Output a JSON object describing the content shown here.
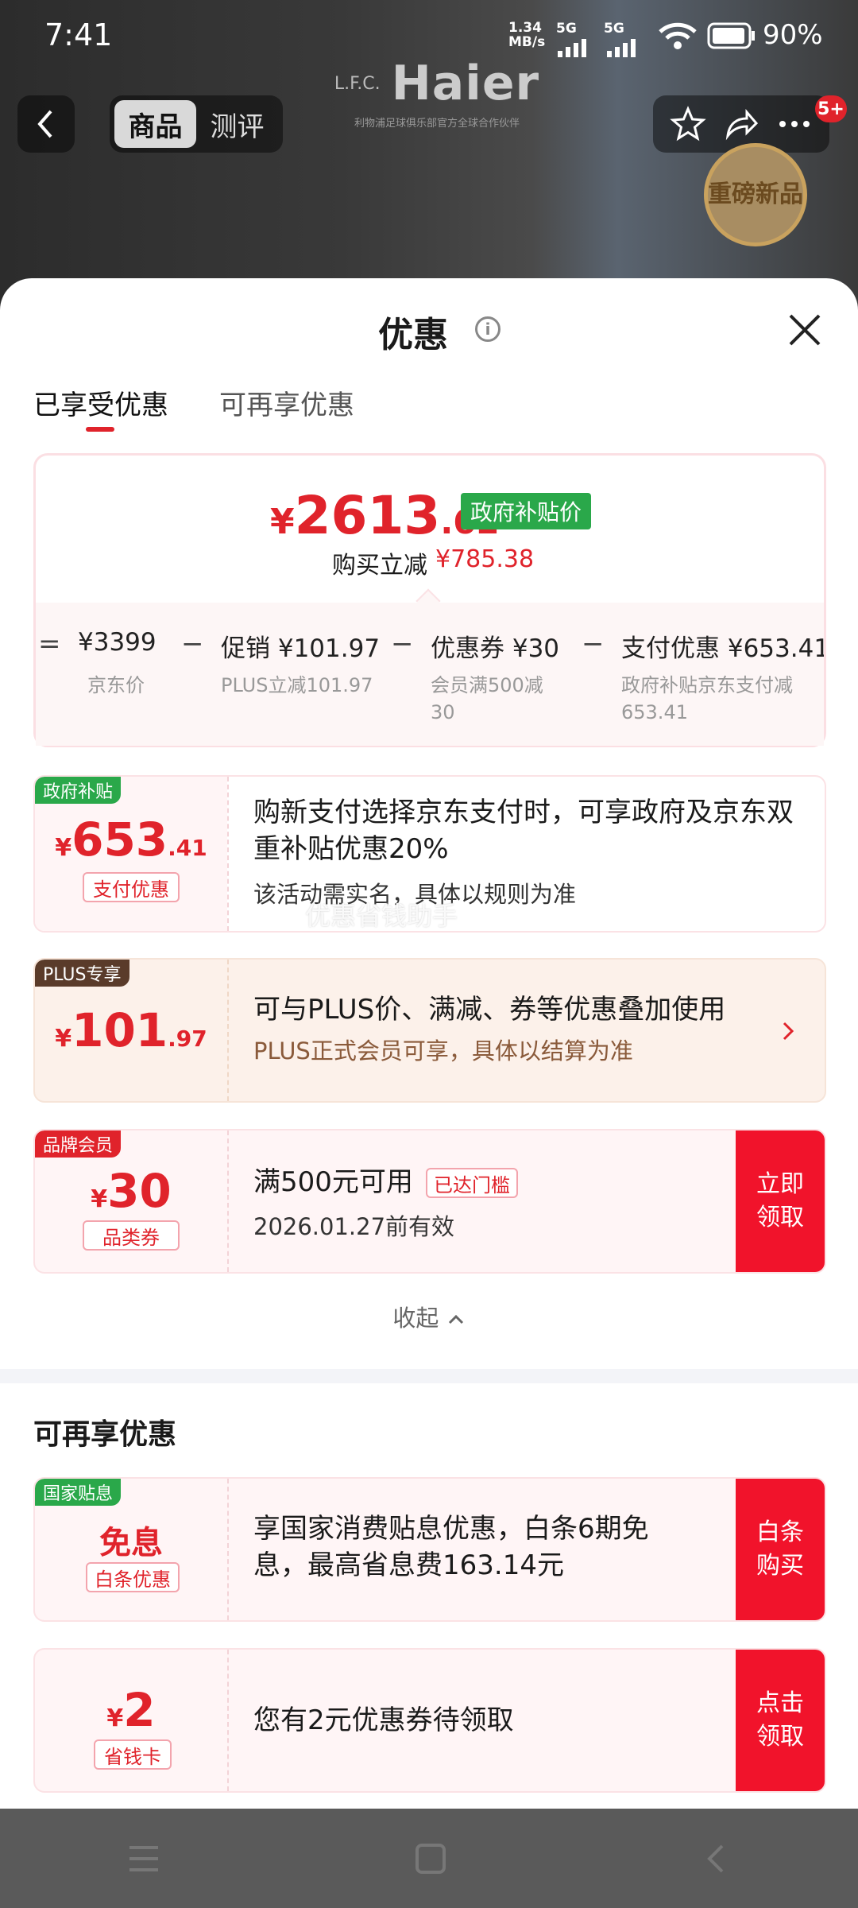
{
  "status_bar": {
    "time": "7:41",
    "net_speed": "1.34 MB/s",
    "signal1": "5G",
    "signal2": "5G",
    "battery": "90%"
  },
  "top_nav": {
    "tab_product": "商品",
    "tab_review": "测评"
  },
  "brand": {
    "logo_text": "Haier",
    "sub_text": "利物浦足球俱乐部官方全球合作伙伴",
    "club": "L.F.C."
  },
  "badge": {
    "notification": "5+",
    "new_product": "重磅新品"
  },
  "sheet": {
    "title": "优惠",
    "tabs": [
      "已享受优惠",
      "可再享优惠"
    ]
  },
  "summary": {
    "price_currency": "¥",
    "price_int": "2613",
    "price_dec": ".62",
    "gov_price_tag": "政府补贴价",
    "reduce_label": "购买立减",
    "reduce_value": "¥785.38",
    "breakdown": [
      {
        "op": "=",
        "label": "¥3399",
        "sub": "京东价"
      },
      {
        "op": "−",
        "label": "促销 ¥101.97",
        "sub": "PLUS立减101.97"
      },
      {
        "op": "−",
        "label": "优惠券 ¥30",
        "sub": "会员满500减30"
      },
      {
        "op": "−",
        "label": "支付优惠 ¥653.41",
        "sub": "政府补贴京东支付减653.41"
      }
    ]
  },
  "cards_applied": [
    {
      "tag": "政府补贴",
      "currency": "¥",
      "amount_int": "653",
      "amount_dec": ".41",
      "sub_tag": "支付优惠",
      "text": "购新支付选择京东支付时，可享政府及京东双重补贴优惠20%",
      "note": "该活动需实名，具体以规则为准",
      "watermark": "优惠省钱助手"
    },
    {
      "tag": "PLUS专享",
      "currency": "¥",
      "amount_int": "101",
      "amount_dec": ".97",
      "text": "可与PLUS价、满减、券等优惠叠加使用",
      "note": "PLUS正式会员可享，具体以结算为准"
    },
    {
      "tag": "品牌会员",
      "currency": "¥",
      "amount_int": "30",
      "sub_tag": "品类券",
      "text": "满500元可用",
      "threshold_badge": "已达门槛",
      "note": "2026.01.27前有效",
      "button": "立即领取"
    }
  ],
  "collapse_label": "收起",
  "section2_title": "可再享优惠",
  "cards_more": [
    {
      "tag": "国家贴息",
      "amount_text": "免息",
      "sub_tag": "白条优惠",
      "text": "享国家消费贴息优惠，白条6期免息，最高省息费163.14元",
      "button": "白条购买"
    },
    {
      "currency": "¥",
      "amount_int": "2",
      "sub_tag": "省钱卡",
      "text": "您有2元优惠券待领取",
      "button": "点击领取"
    }
  ],
  "colors": {
    "accent_red": "#e0232b",
    "button_red": "#f1132b",
    "gov_green": "#2aa84a",
    "plus_brown": "#5a3b2a"
  }
}
